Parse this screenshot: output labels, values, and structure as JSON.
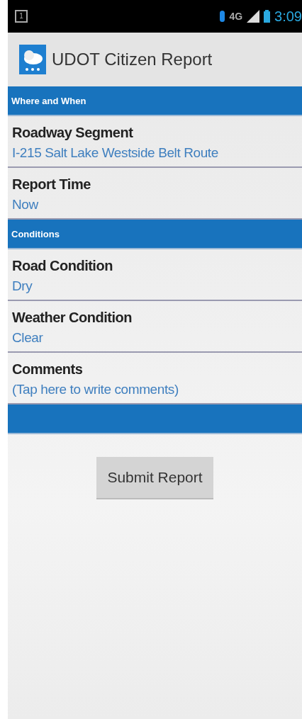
{
  "status_bar": {
    "notification": "1",
    "network": "4G",
    "time": "3:09"
  },
  "app_bar": {
    "title": "UDOT Citizen Report"
  },
  "sections": [
    {
      "title": "Where and When",
      "items": [
        {
          "label": "Roadway Segment",
          "value": "I-215 Salt Lake Westside Belt Route"
        },
        {
          "label": "Report Time",
          "value": "Now"
        }
      ]
    },
    {
      "title": "Conditions",
      "items": [
        {
          "label": "Road Condition",
          "value": "Dry"
        },
        {
          "label": "Weather Condition",
          "value": "Clear"
        },
        {
          "label": "Comments",
          "value": "(Tap here to write comments)"
        }
      ]
    }
  ],
  "submit_button": "Submit Report"
}
